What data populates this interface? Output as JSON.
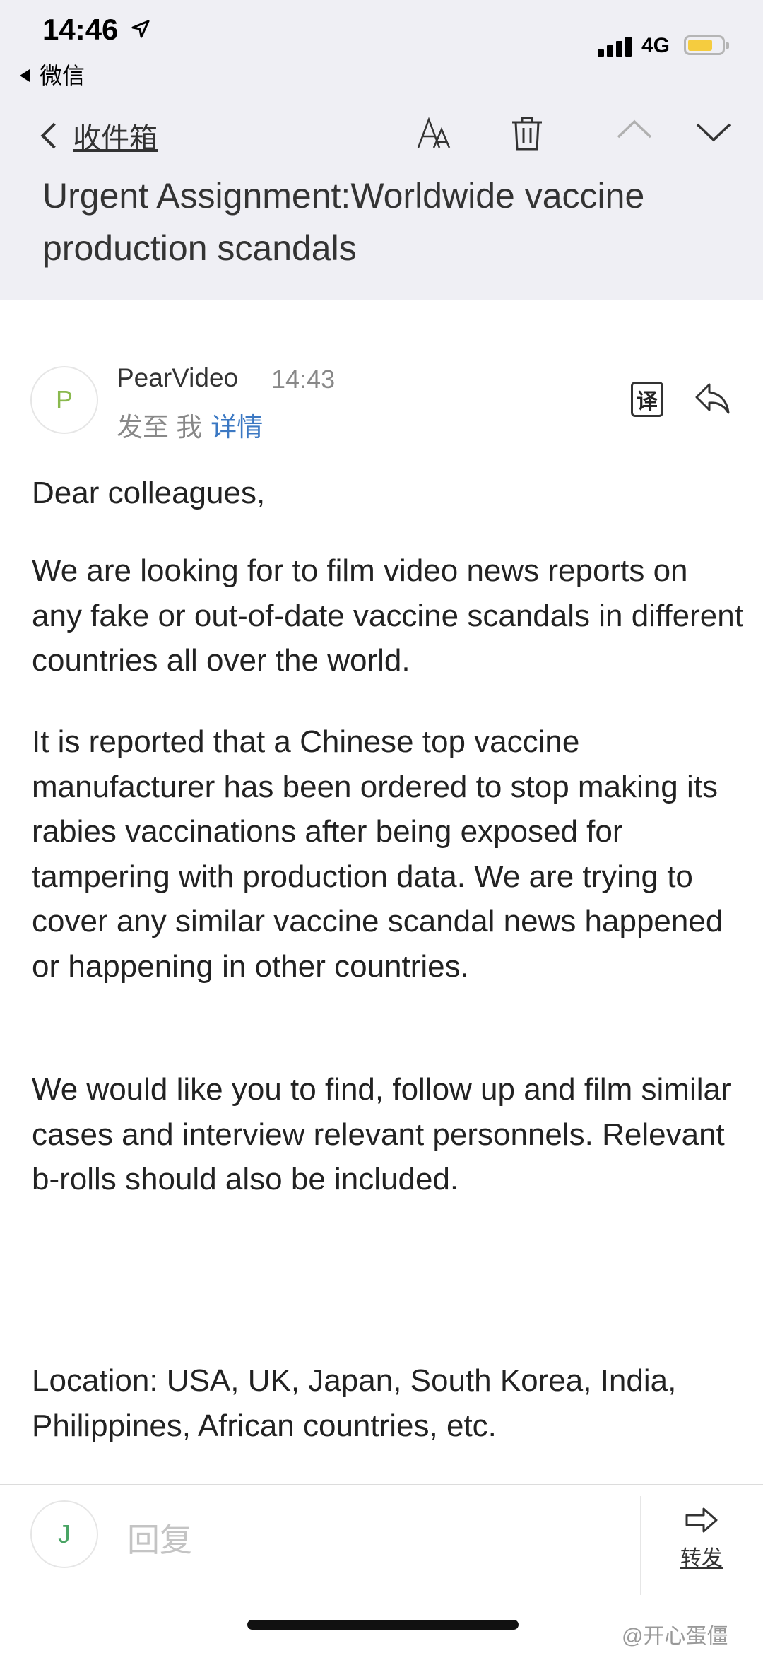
{
  "status_bar": {
    "time": "14:46",
    "back_app": "微信",
    "network": "4G",
    "battery_color": "#f5cc3f"
  },
  "nav": {
    "back_label": "收件箱",
    "icons": [
      "font-size-icon",
      "trash-icon",
      "chevron-up-icon",
      "chevron-down-icon"
    ]
  },
  "email": {
    "subject": "Urgent Assignment:Worldwide vaccine production scandals",
    "sender_initial": "P",
    "sender_name": "PearVideo",
    "time": "14:43",
    "to_line": "发至 我",
    "details_link": "详情",
    "translate_label": "译",
    "body": [
      "Dear colleagues,",
      "We are looking for to film video news reports on any fake or out-of-date vaccine scandals in different countries all over the world.",
      "It is reported that a Chinese top vaccine manufacturer has been ordered to stop making its rabies vaccinations after being exposed for tampering with production data. We are trying to cover any similar vaccine scandal news happened or happening in other countries.",
      "We would like you to find, follow up and film similar cases and interview relevant personnels. Relevant b-rolls should also be included.",
      "Location: USA, UK, Japan, South Korea, India, Philippines, African countries, etc."
    ]
  },
  "bottom_bar": {
    "user_initial": "J",
    "reply_placeholder": "回复",
    "forward_label": "转发"
  },
  "watermark": "@开心蛋僵",
  "colors": {
    "header_bg": "#efeff4",
    "link_blue": "#3b78c3",
    "avatar_green": "#8ab94e"
  }
}
